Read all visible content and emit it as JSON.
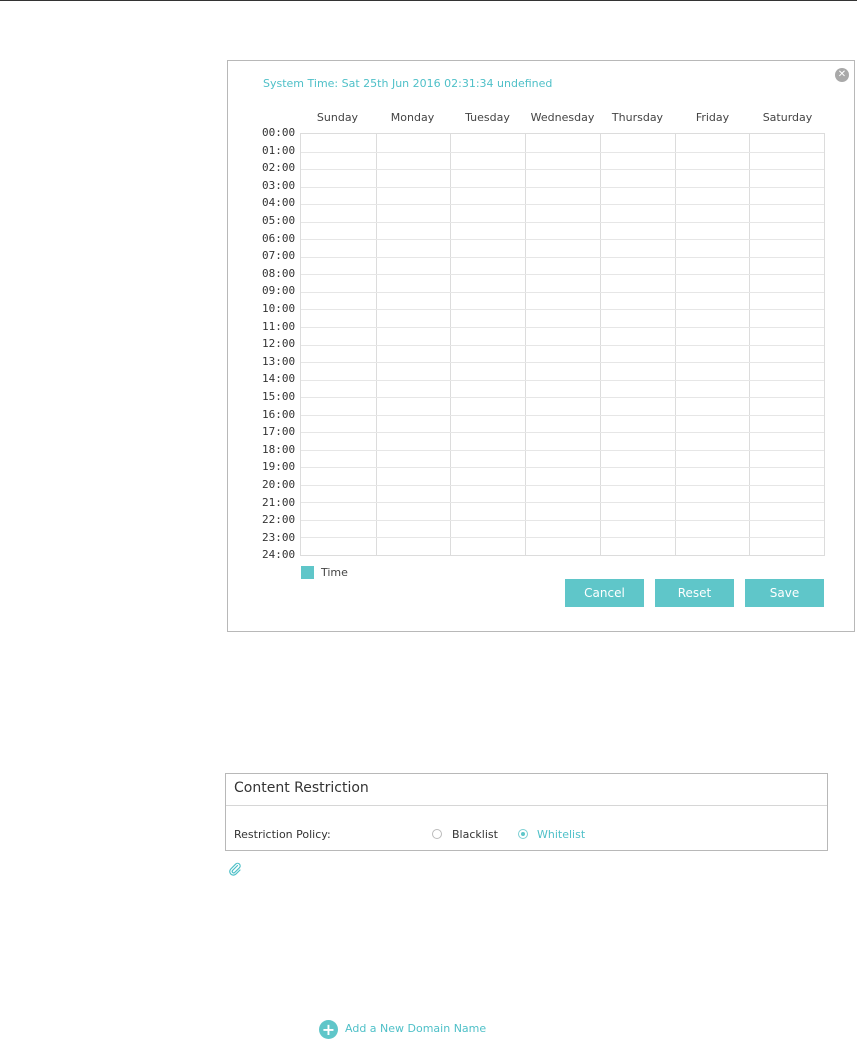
{
  "schedule": {
    "system_time": "System Time: Sat 25th Jun 2016 02:31:34 undefined",
    "close_icon": "close-icon",
    "days": [
      "Sunday",
      "Monday",
      "Tuesday",
      "Wednesday",
      "Thursday",
      "Friday",
      "Saturday"
    ],
    "hours": [
      "00:00",
      "01:00",
      "02:00",
      "03:00",
      "04:00",
      "05:00",
      "06:00",
      "07:00",
      "08:00",
      "09:00",
      "10:00",
      "11:00",
      "12:00",
      "13:00",
      "14:00",
      "15:00",
      "16:00",
      "17:00",
      "18:00",
      "19:00",
      "20:00",
      "21:00",
      "22:00",
      "23:00",
      "24:00"
    ],
    "legend_label": "Time",
    "buttons": {
      "cancel": "Cancel",
      "reset": "Reset",
      "save": "Save"
    }
  },
  "content_restriction": {
    "title": "Content Restriction",
    "policy_label": "Restriction Policy:",
    "options": [
      {
        "label": "Blacklist",
        "selected": false
      },
      {
        "label": "Whitelist",
        "selected": true
      }
    ]
  },
  "note_icon": "paperclip-icon",
  "add_domain": {
    "label": "Add a New Domain Name",
    "icon": "plus-circle-icon"
  },
  "colors": {
    "accent": "#5fc6c9",
    "accent_text": "#4fc0c8",
    "grid_line": "#dcdcdc"
  }
}
